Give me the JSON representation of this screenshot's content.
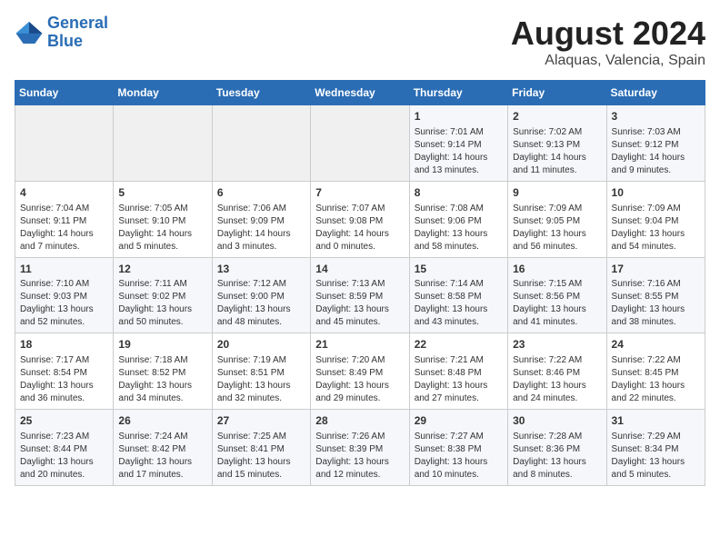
{
  "logo": {
    "line1": "General",
    "line2": "Blue"
  },
  "title": "August 2024",
  "subtitle": "Alaquas, Valencia, Spain",
  "weekdays": [
    "Sunday",
    "Monday",
    "Tuesday",
    "Wednesday",
    "Thursday",
    "Friday",
    "Saturday"
  ],
  "weeks": [
    [
      {
        "day": "",
        "info": ""
      },
      {
        "day": "",
        "info": ""
      },
      {
        "day": "",
        "info": ""
      },
      {
        "day": "",
        "info": ""
      },
      {
        "day": "1",
        "info": "Sunrise: 7:01 AM\nSunset: 9:14 PM\nDaylight: 14 hours\nand 13 minutes."
      },
      {
        "day": "2",
        "info": "Sunrise: 7:02 AM\nSunset: 9:13 PM\nDaylight: 14 hours\nand 11 minutes."
      },
      {
        "day": "3",
        "info": "Sunrise: 7:03 AM\nSunset: 9:12 PM\nDaylight: 14 hours\nand 9 minutes."
      }
    ],
    [
      {
        "day": "4",
        "info": "Sunrise: 7:04 AM\nSunset: 9:11 PM\nDaylight: 14 hours\nand 7 minutes."
      },
      {
        "day": "5",
        "info": "Sunrise: 7:05 AM\nSunset: 9:10 PM\nDaylight: 14 hours\nand 5 minutes."
      },
      {
        "day": "6",
        "info": "Sunrise: 7:06 AM\nSunset: 9:09 PM\nDaylight: 14 hours\nand 3 minutes."
      },
      {
        "day": "7",
        "info": "Sunrise: 7:07 AM\nSunset: 9:08 PM\nDaylight: 14 hours\nand 0 minutes."
      },
      {
        "day": "8",
        "info": "Sunrise: 7:08 AM\nSunset: 9:06 PM\nDaylight: 13 hours\nand 58 minutes."
      },
      {
        "day": "9",
        "info": "Sunrise: 7:09 AM\nSunset: 9:05 PM\nDaylight: 13 hours\nand 56 minutes."
      },
      {
        "day": "10",
        "info": "Sunrise: 7:09 AM\nSunset: 9:04 PM\nDaylight: 13 hours\nand 54 minutes."
      }
    ],
    [
      {
        "day": "11",
        "info": "Sunrise: 7:10 AM\nSunset: 9:03 PM\nDaylight: 13 hours\nand 52 minutes."
      },
      {
        "day": "12",
        "info": "Sunrise: 7:11 AM\nSunset: 9:02 PM\nDaylight: 13 hours\nand 50 minutes."
      },
      {
        "day": "13",
        "info": "Sunrise: 7:12 AM\nSunset: 9:00 PM\nDaylight: 13 hours\nand 48 minutes."
      },
      {
        "day": "14",
        "info": "Sunrise: 7:13 AM\nSunset: 8:59 PM\nDaylight: 13 hours\nand 45 minutes."
      },
      {
        "day": "15",
        "info": "Sunrise: 7:14 AM\nSunset: 8:58 PM\nDaylight: 13 hours\nand 43 minutes."
      },
      {
        "day": "16",
        "info": "Sunrise: 7:15 AM\nSunset: 8:56 PM\nDaylight: 13 hours\nand 41 minutes."
      },
      {
        "day": "17",
        "info": "Sunrise: 7:16 AM\nSunset: 8:55 PM\nDaylight: 13 hours\nand 38 minutes."
      }
    ],
    [
      {
        "day": "18",
        "info": "Sunrise: 7:17 AM\nSunset: 8:54 PM\nDaylight: 13 hours\nand 36 minutes."
      },
      {
        "day": "19",
        "info": "Sunrise: 7:18 AM\nSunset: 8:52 PM\nDaylight: 13 hours\nand 34 minutes."
      },
      {
        "day": "20",
        "info": "Sunrise: 7:19 AM\nSunset: 8:51 PM\nDaylight: 13 hours\nand 32 minutes."
      },
      {
        "day": "21",
        "info": "Sunrise: 7:20 AM\nSunset: 8:49 PM\nDaylight: 13 hours\nand 29 minutes."
      },
      {
        "day": "22",
        "info": "Sunrise: 7:21 AM\nSunset: 8:48 PM\nDaylight: 13 hours\nand 27 minutes."
      },
      {
        "day": "23",
        "info": "Sunrise: 7:22 AM\nSunset: 8:46 PM\nDaylight: 13 hours\nand 24 minutes."
      },
      {
        "day": "24",
        "info": "Sunrise: 7:22 AM\nSunset: 8:45 PM\nDaylight: 13 hours\nand 22 minutes."
      }
    ],
    [
      {
        "day": "25",
        "info": "Sunrise: 7:23 AM\nSunset: 8:44 PM\nDaylight: 13 hours\nand 20 minutes."
      },
      {
        "day": "26",
        "info": "Sunrise: 7:24 AM\nSunset: 8:42 PM\nDaylight: 13 hours\nand 17 minutes."
      },
      {
        "day": "27",
        "info": "Sunrise: 7:25 AM\nSunset: 8:41 PM\nDaylight: 13 hours\nand 15 minutes."
      },
      {
        "day": "28",
        "info": "Sunrise: 7:26 AM\nSunset: 8:39 PM\nDaylight: 13 hours\nand 12 minutes."
      },
      {
        "day": "29",
        "info": "Sunrise: 7:27 AM\nSunset: 8:38 PM\nDaylight: 13 hours\nand 10 minutes."
      },
      {
        "day": "30",
        "info": "Sunrise: 7:28 AM\nSunset: 8:36 PM\nDaylight: 13 hours\nand 8 minutes."
      },
      {
        "day": "31",
        "info": "Sunrise: 7:29 AM\nSunset: 8:34 PM\nDaylight: 13 hours\nand 5 minutes."
      }
    ]
  ]
}
